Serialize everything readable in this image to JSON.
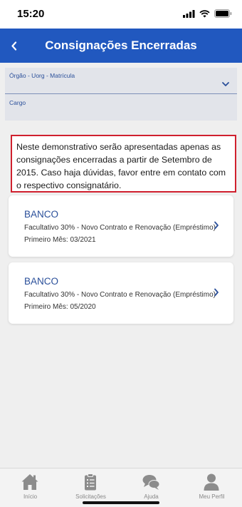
{
  "status_bar": {
    "time": "15:20",
    "icons": [
      "signal-icon",
      "wifi-icon",
      "battery-icon"
    ]
  },
  "header": {
    "title": "Consignações Encerradas",
    "back_icon": "back-chevron-icon",
    "color": "#2158bf"
  },
  "fields": {
    "orgao_label": "Órgão - Uorg - Matrícula",
    "cargo_label": "Cargo"
  },
  "notice": {
    "text": "Neste demonstrativo serão apresentadas apenas as consignações encerradas a partir de Setembro de 2015. Caso haja dúvidas, favor entre em contato com o respectivo consignatário.",
    "border_color": "#d0202e"
  },
  "consignments": [
    {
      "bank": "BANCO",
      "description": "Facultativo 30% - Novo Contrato e Renovação (Empréstimo)",
      "first_month": "Primeiro Mês: 03/2021"
    },
    {
      "bank": "BANCO",
      "description": "Facultativo 30% - Novo Contrato e Renovação (Empréstimo)",
      "first_month": "Primeiro Mês: 05/2020"
    }
  ],
  "tab_bar": {
    "tabs": [
      {
        "label": "Início",
        "icon": "home-icon"
      },
      {
        "label": "Solicitações",
        "icon": "clipboard-icon"
      },
      {
        "label": "Ajuda",
        "icon": "chat-bubbles-icon"
      },
      {
        "label": "Meu Perfil",
        "icon": "user-icon"
      }
    ]
  }
}
